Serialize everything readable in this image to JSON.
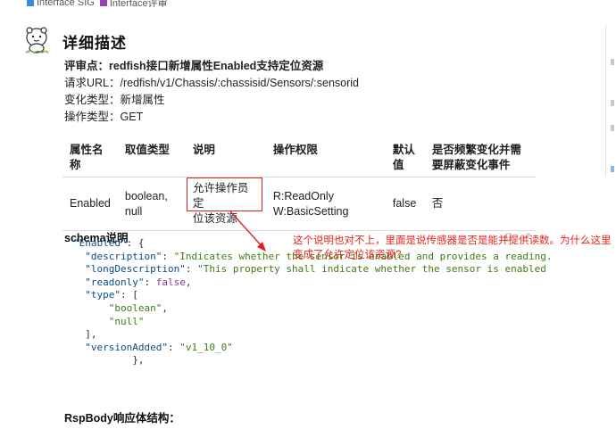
{
  "tags": [
    {
      "label": "Interface SIG",
      "color": "#2f8de0"
    },
    {
      "label": "Interface评审",
      "color": "#9b3fb8"
    }
  ],
  "heading": "详细描述",
  "meta": {
    "review_label": "评审点：",
    "review_value": "redfish接口新增属性Enabled支持定位资源",
    "url_label": "请求URL：",
    "url_value": "/redfish/v1/Chassis/:chassisid/Sensors/:sensorid",
    "change_label": "变化类型：",
    "change_value": "新增属性",
    "op_label": "操作类型：",
    "op_value": "GET"
  },
  "table": {
    "headers": [
      "属性名称",
      "取值类型",
      "说明",
      "操作权限",
      "默认值",
      "是否频繁变化并需要屏蔽变化事件"
    ],
    "row": {
      "name": "Enabled",
      "type_line1": "boolean,",
      "type_line2": "null",
      "desc_line1": "允许操作员定",
      "desc_line2": "位该资源",
      "perm_line1": "R:ReadOnly",
      "perm_line2": "W:BasicSetting",
      "default": "false",
      "frequent": "否"
    }
  },
  "schema_title": "schema说明",
  "comment": {
    "line1": "这个说明也对不上，里面是说传感器是否是能并提供读数。为什么这里",
    "line2": "变成了允许定位该资源?"
  },
  "code": {
    "root_key": "\"Enabled\"",
    "desc_key": "\"description\"",
    "desc_val": "\"Indicates whether the sensor is enabled and provides a reading.",
    "long_key": "\"longDescription\"",
    "long_val": "\"This property shall indicate whether the sensor is enabled",
    "readonly_key": "\"readonly\"",
    "readonly_val": "false",
    "type_key": "\"type\"",
    "type_v1": "\"boolean\"",
    "type_v2": "\"null\"",
    "version_key": "\"versionAdded\"",
    "version_val": "\"v1_10_0\""
  },
  "footer_title": "RspBody响应体结构："
}
